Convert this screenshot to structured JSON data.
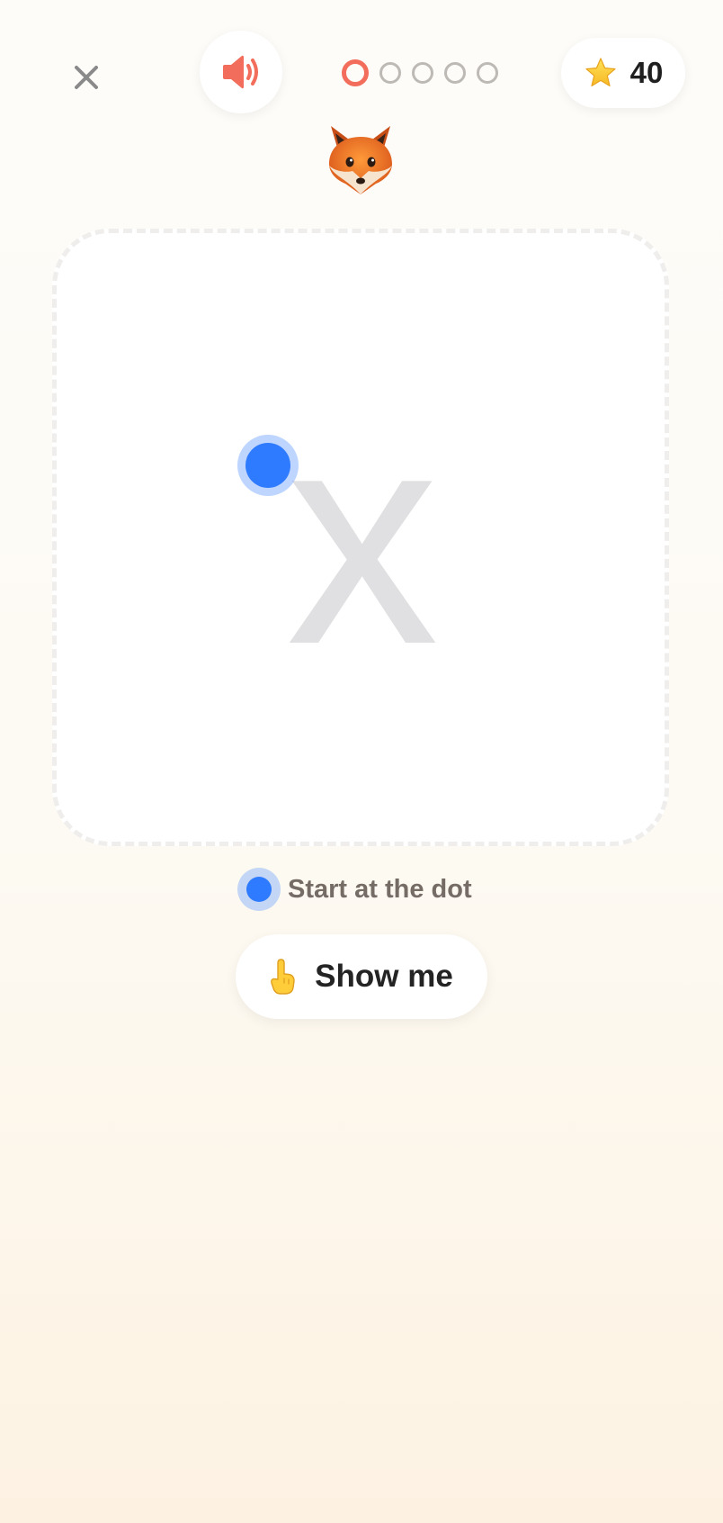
{
  "header": {
    "close_icon": "close-icon",
    "sound_icon": "speaker-icon",
    "progress": {
      "total": 5,
      "current": 1
    },
    "score": {
      "icon": "star-icon",
      "value": "40"
    }
  },
  "mascot": {
    "icon": "fox-face-icon"
  },
  "tracing": {
    "letter": "x",
    "start_dot_icon": "start-dot-icon"
  },
  "hint": {
    "text": "Start at the dot"
  },
  "show_me": {
    "icon": "pointing-finger-icon",
    "label": "Show me"
  },
  "colors": {
    "accent_red": "#f26d5b",
    "dot_blue": "#2f7bff",
    "letter_gray": "#e0e0e2",
    "hint_text": "#756c66"
  }
}
